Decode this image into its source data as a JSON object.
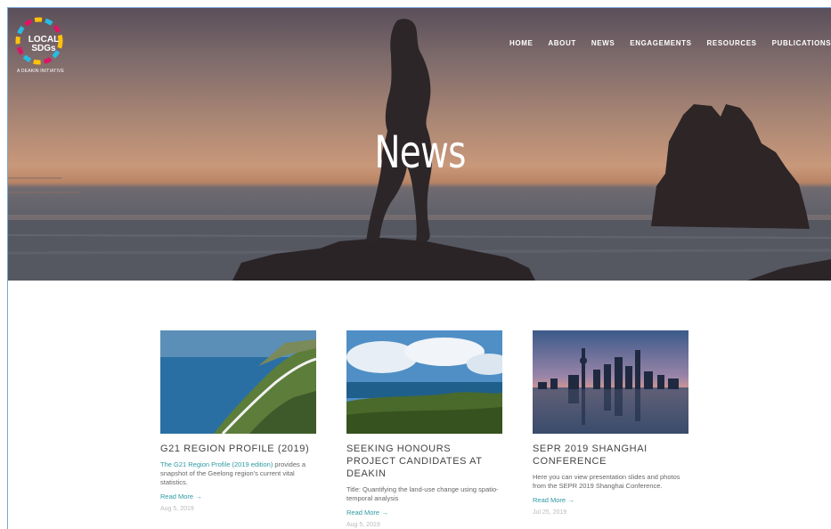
{
  "logo": {
    "line1": "LOCAL",
    "line2": "SDGs",
    "tagline": "A DEAKIN INITIATIVE"
  },
  "nav": [
    "HOME",
    "ABOUT",
    "NEWS",
    "ENGAGEMENTS",
    "RESOURCES",
    "PUBLICATIONS"
  ],
  "hero": {
    "title": "News"
  },
  "posts": [
    {
      "title": "G21 REGION PROFILE (2019)",
      "excerpt_link": "The G21 Region Profile (2019 edition)",
      "excerpt": " provides a snapshot of the Geelong region's current vital statistics.",
      "read_more": "Read More →",
      "date": "Aug 5, 2019"
    },
    {
      "title": "SEEKING HONOURS PROJECT CANDIDATES AT DEAKIN",
      "excerpt_link": "",
      "excerpt": "Title: Quantifying the land-use change using spatio-temporal analysis",
      "read_more": "Read More →",
      "date": "Aug 5, 2019"
    },
    {
      "title": "SEPR 2019 SHANGHAI CONFERENCE",
      "excerpt_link": "",
      "excerpt": "Here you can view presentation slides and photos from the SEPR 2019 Shanghai Conference.",
      "read_more": "Read More →",
      "date": "Jul 25, 2019"
    }
  ]
}
